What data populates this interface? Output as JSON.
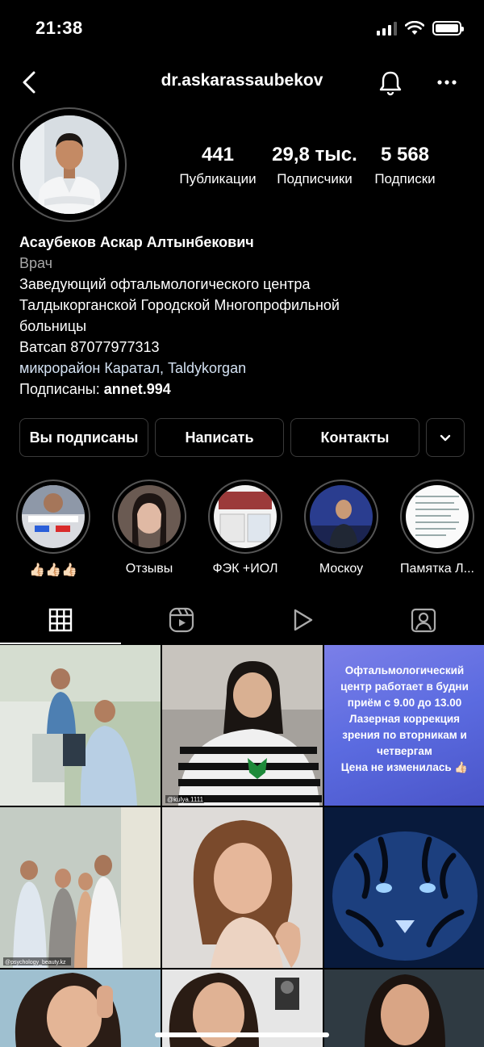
{
  "status_bar": {
    "time": "21:38"
  },
  "header": {
    "username": "dr.askarassaubekov"
  },
  "stats": [
    {
      "value": "441",
      "label": "Публикации"
    },
    {
      "value": "29,8 тыс.",
      "label": "Подписчики"
    },
    {
      "value": "5 568",
      "label": "Подписки"
    }
  ],
  "bio": {
    "name": "Асаубеков Аскар Алтынбекович",
    "category": "Врач",
    "line1": "Заведующий офтальмологического центра",
    "line2": "Талдыкорганской Городской Многопрофильной",
    "line3": "больницы",
    "line4": "Ватсап 87077977313",
    "location": "микрорайон Каратал, Taldykorgan",
    "followed_prefix": "Подписаны: ",
    "followed_user": "annet.994"
  },
  "buttons": {
    "following": "Вы подписаны",
    "message": "Написать",
    "contacts": "Контакты"
  },
  "highlights": [
    {
      "label": "👍🏻👍🏻👍🏻"
    },
    {
      "label": "Отзывы"
    },
    {
      "label": "ФЭК +ИОЛ"
    },
    {
      "label": "Москоу"
    },
    {
      "label": "Памятка Л..."
    }
  ],
  "tabs": [
    "grid-icon",
    "reels-icon",
    "video-icon",
    "tagged-icon"
  ],
  "posts": {
    "post3_text_1": "Офтальмологический",
    "post3_text_2": "центр работает в будни",
    "post3_text_3": "приём с 9.00 до 13.00",
    "post3_text_4": "Лазерная коррекция",
    "post3_text_5": "зрения по вторникам и",
    "post3_text_6": "четвергам",
    "post3_text_7": "Цена не изменилась 👍🏻",
    "post2_tag": "@kulya.1111",
    "post4_tag": "@psychology_beauty.kz"
  },
  "colors": {
    "accent_post": "#5b6be0",
    "link": "#d3e1f2",
    "secondary": "#a8a8a8"
  }
}
